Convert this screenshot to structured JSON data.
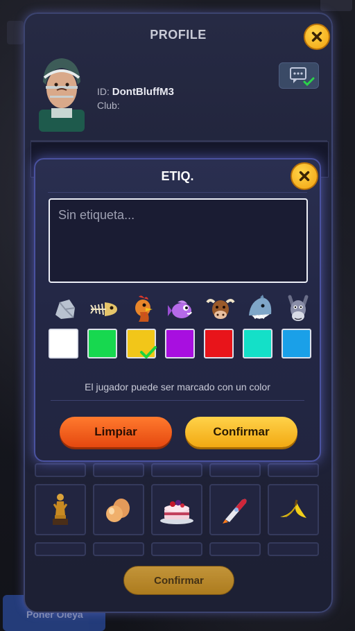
{
  "profile": {
    "title": "PROFILE",
    "id_label": "ID:",
    "username": "DontBluffM3",
    "club_label": "Club:",
    "confirm_label": "Confirmar",
    "gift_icons": [
      "trophy-icon",
      "egg-icon",
      "cake-icon",
      "rocket-icon",
      "banana-peel-icon"
    ]
  },
  "background": {
    "bottom_button_label": "Poner Oleya"
  },
  "etiq": {
    "title": "ETIQ.",
    "placeholder": "Sin etiqueta...",
    "animal_icons": [
      "rock-icon",
      "fish-bone-icon",
      "chicken-icon",
      "fish-icon",
      "bull-icon",
      "shark-icon",
      "donkey-icon"
    ],
    "colors": [
      "#ffffff",
      "#17d84f",
      "#f2c619",
      "#a80fe0",
      "#e8141a",
      "#14e0c8",
      "#1aa0e8"
    ],
    "selected_color_index": 2,
    "hint": "El jugador puede ser marcado con un color",
    "clear_label": "Limpiar",
    "confirm_label": "Confirmar"
  }
}
